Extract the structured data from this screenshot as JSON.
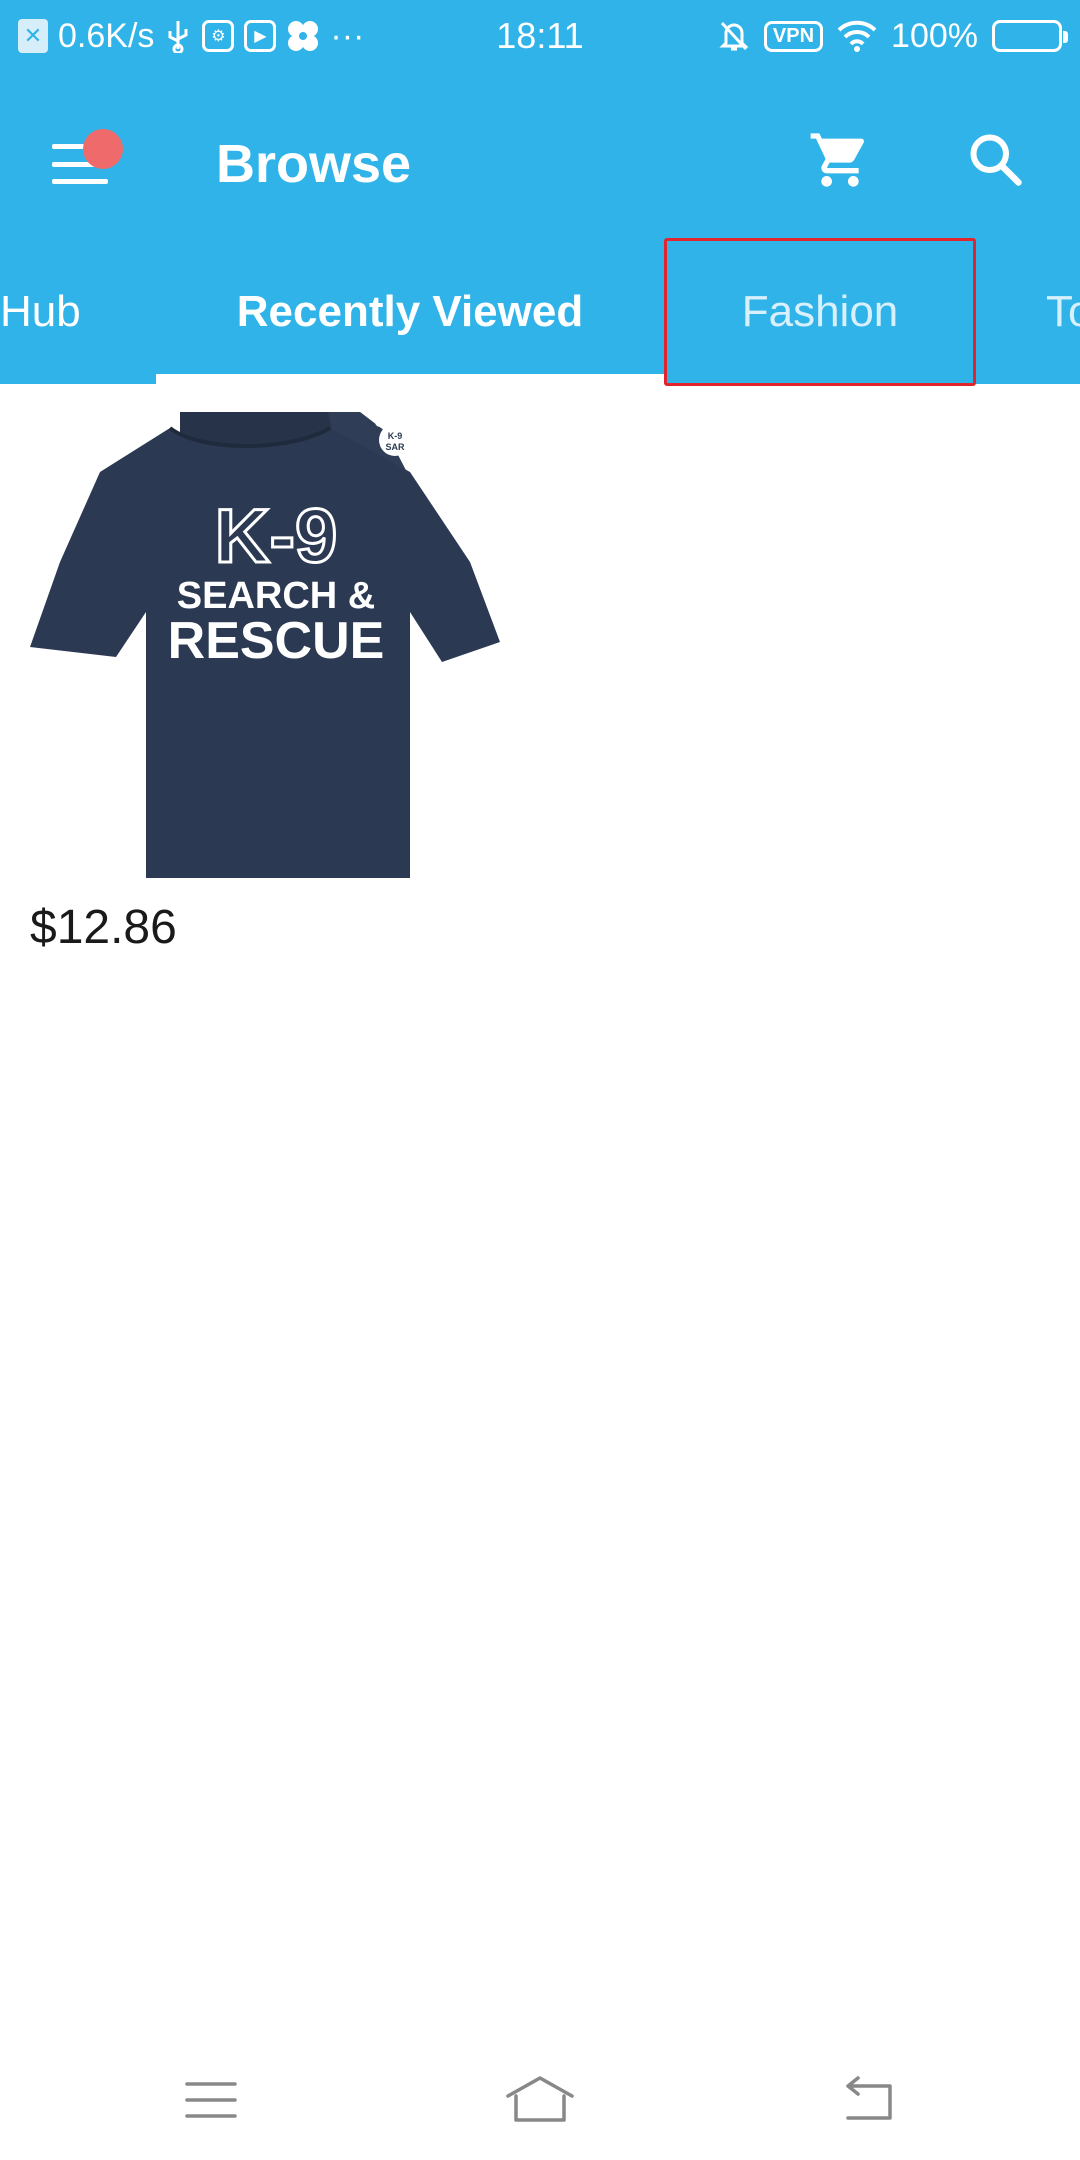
{
  "status_bar": {
    "network_speed": "0.6K/s",
    "time": "18:11",
    "vpn_label": "VPN",
    "battery": "100%"
  },
  "app_bar": {
    "title": "Browse",
    "has_notification": true
  },
  "tabs": [
    {
      "label": "Hub",
      "selected": false
    },
    {
      "label": "Recently Viewed",
      "selected": true
    },
    {
      "label": "Fashion",
      "selected": false,
      "highlighted": true
    },
    {
      "label": "To",
      "selected": false
    }
  ],
  "products": [
    {
      "image_text": {
        "line1": "K-9",
        "line2": "SEARCH &",
        "line3": "RESCUE",
        "logo_line1": "K-9",
        "logo_line2": "SAR"
      },
      "price": "$12.86"
    }
  ],
  "colors": {
    "primary": "#30b3e8",
    "highlight_border": "#e0262c",
    "notification_dot": "#ef6a6a",
    "shirt": "#2b3a52"
  }
}
